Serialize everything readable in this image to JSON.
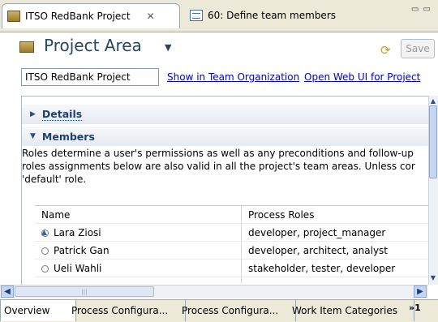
{
  "editor_tabs": [
    {
      "label": "ITSO RedBank Project",
      "icon": "project-area-icon",
      "active": true
    },
    {
      "label": "60: Define team members",
      "icon": "work-item-icon",
      "active": false
    }
  ],
  "header": {
    "title": "Project Area",
    "save_label": "Save"
  },
  "project_name_field": {
    "value": "ITSO RedBank Project"
  },
  "links": {
    "show_in_team_org": "Show in Team Organization",
    "open_web_ui": "Open Web UI for Project"
  },
  "sections": {
    "details": "Details",
    "members": "Members"
  },
  "members_description": [
    "Roles determine a user's permissions as well as any preconditions and follow-up",
    "roles assignments below are also valid in all the project's team areas. Unless cor",
    "'default' role."
  ],
  "members_table": {
    "columns": [
      "Name",
      "Process Roles"
    ],
    "rows": [
      {
        "name": "Lara Ziosi",
        "roles": "developer, project_manager"
      },
      {
        "name": "Patrick Gan",
        "roles": "developer, architect, analyst"
      },
      {
        "name": "Ueli Wahli",
        "roles": "stakeholder, tester, developer"
      }
    ]
  },
  "bottom_tabs": [
    "Overview",
    "Process Configura...",
    "Process Configura...",
    "Work Item Categories"
  ],
  "more_tabs_label": "»1",
  "colors": {
    "header_text": "#27465f",
    "link": "#0000cc",
    "section_text": "#1f3f6f"
  }
}
